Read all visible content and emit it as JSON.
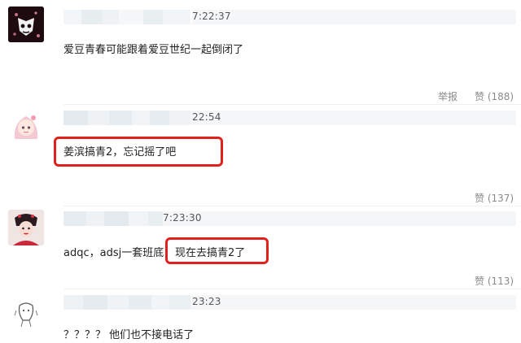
{
  "comments": [
    {
      "time": "7:22:37",
      "text": "爱豆青春可能跟着爱豆世纪一起倒闭了",
      "report_label": "举报",
      "like_label": "赞",
      "like_count": "(188)"
    },
    {
      "time": "22:54",
      "text": "姜滨搞青2，忘记摇了吧",
      "like_label": "赞",
      "like_count": "(137)"
    },
    {
      "time": "7:23:30",
      "text_a": "adqc，adsj一套班底，",
      "text_b": "现在去搞青2了",
      "like_label": "赞",
      "like_count": "(113)"
    },
    {
      "time": "23:23",
      "text": "？？？？ 他们也不接电话了"
    }
  ],
  "colors": {
    "highlight": "#e0211d",
    "muted": "#8a8a8a",
    "text": "#222222"
  },
  "icons": [
    "avatar-dark-cartoon",
    "avatar-anime-girl",
    "avatar-opera-woman",
    "avatar-sketch"
  ]
}
